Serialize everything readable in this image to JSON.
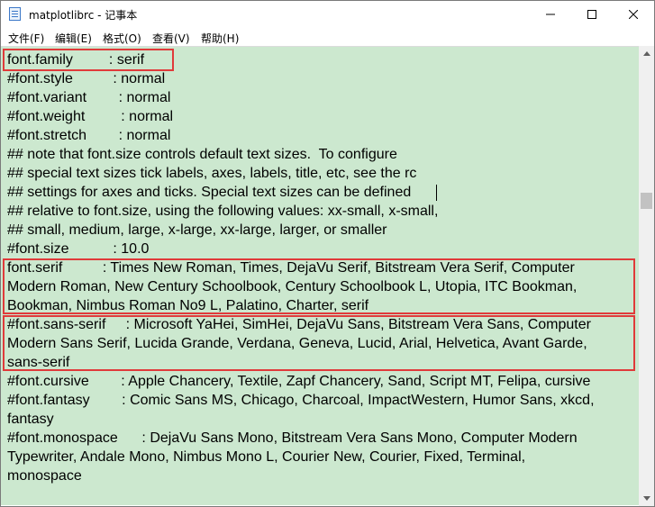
{
  "window": {
    "title": "matplotlibrc - 记事本",
    "minimize_icon": "minimize-icon",
    "maximize_icon": "maximize-icon",
    "close_icon": "close-icon"
  },
  "menu": [
    {
      "label": "文件(F)"
    },
    {
      "label": "编辑(E)"
    },
    {
      "label": "格式(O)"
    },
    {
      "label": "查看(V)"
    },
    {
      "label": "帮助(H)"
    }
  ],
  "editor": {
    "background": "#cce8cf",
    "highlight_color": "#e03a3a",
    "lines": [
      "font.family         : serif",
      "#font.style          : normal",
      "#font.variant        : normal",
      "#font.weight         : normal",
      "#font.stretch        : normal",
      "## note that font.size controls default text sizes.  To configure",
      "## special text sizes tick labels, axes, labels, title, etc, see the rc",
      "## settings for axes and ticks. Special text sizes can be defined",
      "## relative to font.size, using the following values: xx-small, x-small,",
      "## small, medium, large, x-large, xx-large, larger, or smaller",
      "#font.size           : 10.0",
      "font.serif          : Times New Roman, Times, DejaVu Serif, Bitstream Vera Serif, Computer",
      "Modern Roman, New Century Schoolbook, Century Schoolbook L, Utopia, ITC Bookman,",
      "Bookman, Nimbus Roman No9 L, Palatino, Charter, serif",
      "#font.sans-serif     : Microsoft YaHei, SimHei, DejaVu Sans, Bitstream Vera Sans, Computer",
      "Modern Sans Serif, Lucida Grande, Verdana, Geneva, Lucid, Arial, Helvetica, Avant Garde,",
      "sans-serif",
      "#font.cursive        : Apple Chancery, Textile, Zapf Chancery, Sand, Script MT, Felipa, cursive",
      "#font.fantasy        : Comic Sans MS, Chicago, Charcoal, ImpactWestern, Humor Sans, xkcd,",
      "fantasy",
      "#font.monospace      : DejaVu Sans Mono, Bitstream Vera Sans Mono, Computer Modern",
      "Typewriter, Andale Mono, Nimbus Mono L, Courier New, Courier, Fixed, Terminal,",
      "monospace"
    ]
  }
}
